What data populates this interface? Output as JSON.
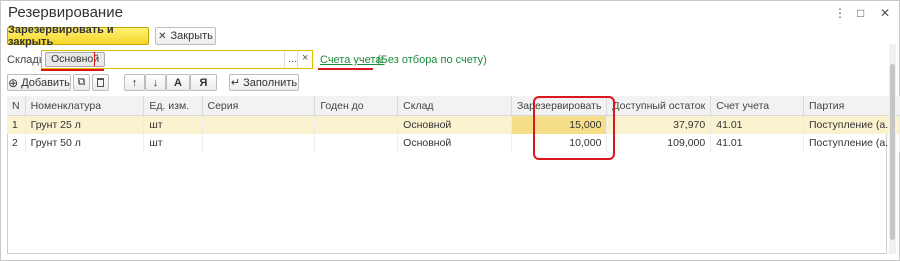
{
  "window": {
    "title": "Резервирование",
    "controls": {
      "more": "⋮",
      "maximize": "□",
      "close": "✕"
    }
  },
  "toolbar": {
    "reserve_close_label": "Зарезервировать и закрыть",
    "close_label": "Закрыть",
    "close_icon": "✕"
  },
  "filter": {
    "warehouses_label": "Склады:",
    "warehouse_tag": "Основной",
    "dots_button": "...",
    "clear_button": "×",
    "accounts_link": "Счета учета:",
    "accounts_note": "(Без отбора по счету)"
  },
  "grid_toolbar": {
    "add_label": "Добавить",
    "add_icon": "⊕",
    "copy_icon": "⧉",
    "delete_icon": "🗑",
    "move_up_icon": "↑",
    "move_down_icon": "↓",
    "sort_asc_icon": "А",
    "sort_desc_icon": "Я",
    "fill_icon": "↵",
    "fill_label": "Заполнить"
  },
  "table": {
    "columns": [
      "N",
      "Номенклатура",
      "Ед. изм.",
      "Серия",
      "Годен до",
      "Склад",
      "Зарезервировать",
      "Доступный остаток",
      "Счет учета",
      "Партия"
    ],
    "rows": [
      {
        "n": "1",
        "item": "Грунт 25 л",
        "unit": "шт",
        "series": "",
        "expires": "",
        "warehouse": "Основной",
        "reserve": "15,000",
        "available": "37,970",
        "account": "41.01",
        "batch": "Поступление (а..."
      },
      {
        "n": "2",
        "item": "Грунт 50 л",
        "unit": "шт",
        "series": "",
        "expires": "",
        "warehouse": "Основной",
        "reserve": "10,000",
        "available": "109,000",
        "account": "41.01",
        "batch": "Поступление (а..."
      }
    ]
  },
  "colors": {
    "accent_yellow": "#f5d52a",
    "highlight_red": "#d9171c",
    "link_green": "#1c8a3c",
    "selected_row": "#fbf2cf"
  }
}
